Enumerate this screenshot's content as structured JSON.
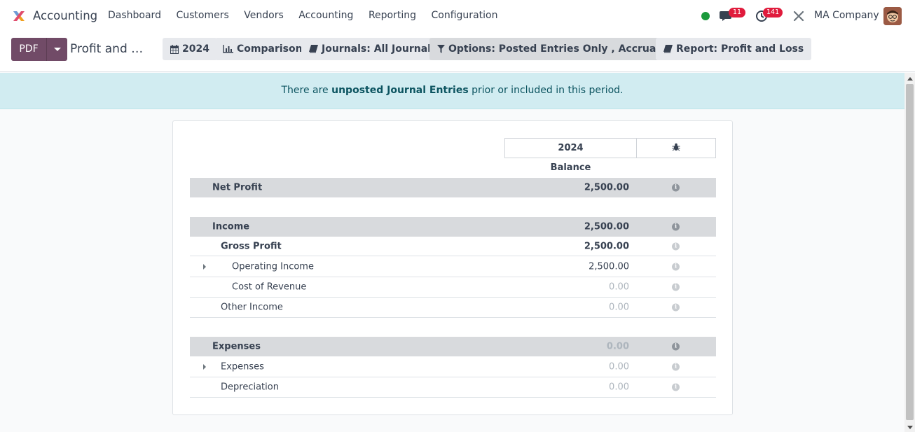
{
  "navbar": {
    "app_name": "Accounting",
    "menu": [
      "Dashboard",
      "Customers",
      "Vendors",
      "Accounting",
      "Reporting",
      "Configuration"
    ],
    "messages_count": "11",
    "activities_count": "141",
    "company": "MA Company",
    "status_color": "#1b9a3c"
  },
  "control_panel": {
    "pdf_label": "PDF",
    "report_title": "Profit and Loss",
    "filters": {
      "date": "2024",
      "comparison": "Comparison",
      "journals": "Journals: All Journals",
      "options": "Options: Posted Entries Only , Accrual Basis",
      "report": "Report: Profit and Loss"
    }
  },
  "alert": {
    "prefix": "There are ",
    "link": "unposted Journal Entries",
    "suffix": " prior or included in this period."
  },
  "report": {
    "column_header": "2024",
    "balance_label": "Balance",
    "rows": [
      {
        "label": "Net Profit",
        "value": "2,500.00"
      },
      {
        "label": "Income",
        "value": "2,500.00"
      },
      {
        "label": "Gross Profit",
        "value": "2,500.00"
      },
      {
        "label": "Operating Income",
        "value": "2,500.00"
      },
      {
        "label": "Cost of Revenue",
        "value": "0.00"
      },
      {
        "label": "Other Income",
        "value": "0.00"
      },
      {
        "label": "Expenses",
        "value": "0.00"
      },
      {
        "label": "Expenses",
        "value": "0.00"
      },
      {
        "label": "Depreciation",
        "value": "0.00"
      }
    ]
  }
}
